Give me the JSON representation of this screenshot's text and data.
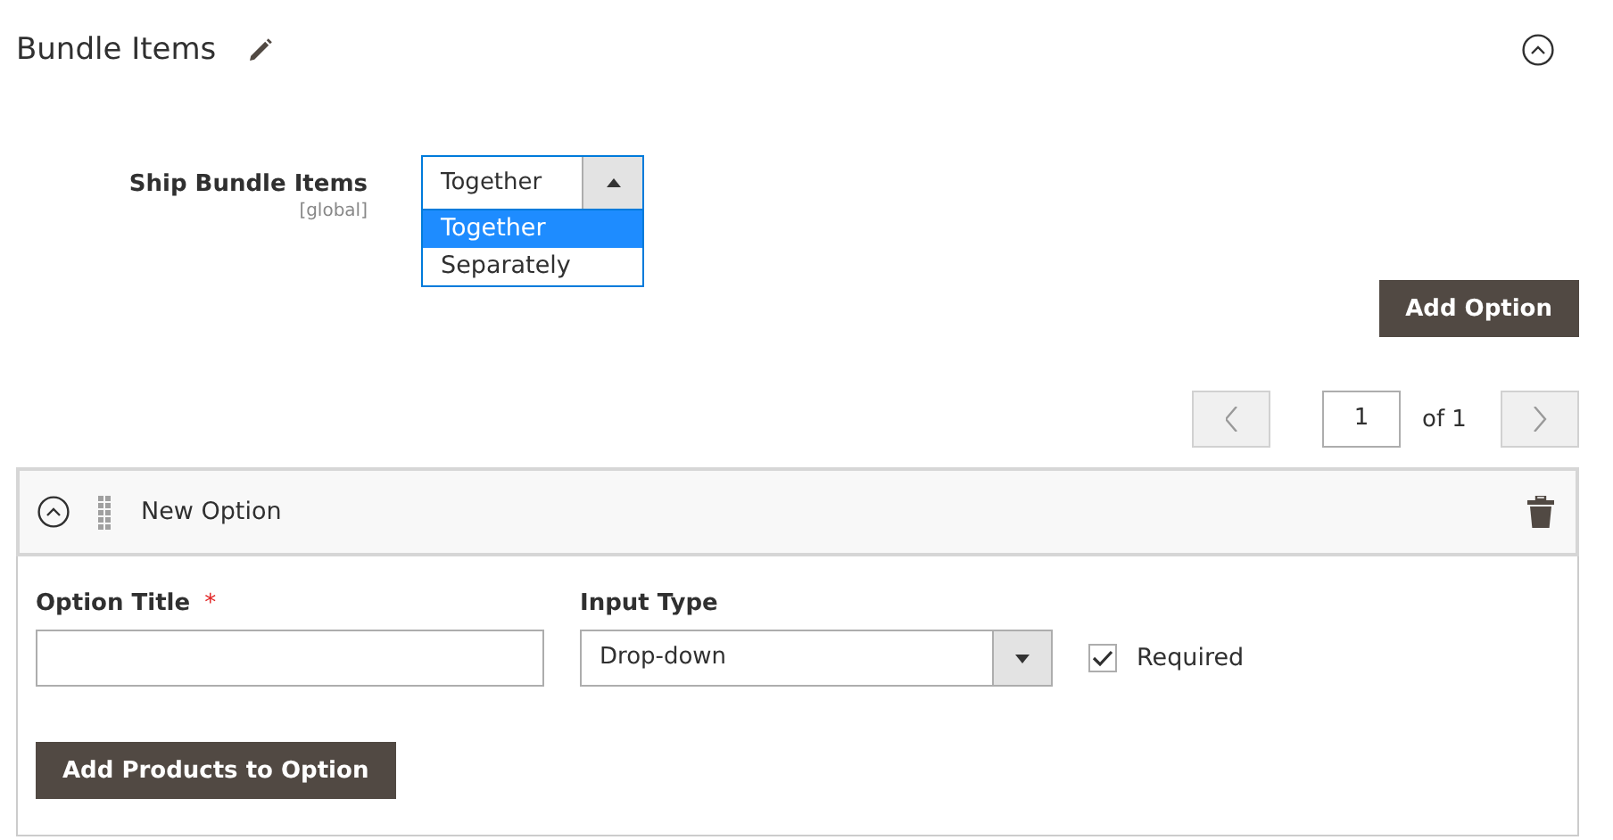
{
  "section": {
    "title": "Bundle Items",
    "expanded": true
  },
  "ship_bundle_items": {
    "label": "Ship Bundle Items",
    "scope": "[global]",
    "value": "Together",
    "open": true,
    "options": [
      {
        "label": "Together",
        "selected": true
      },
      {
        "label": "Separately",
        "selected": false
      }
    ]
  },
  "add_option_button": "Add Option",
  "pager": {
    "page": "1",
    "of": "of 1"
  },
  "options": [
    {
      "header": "New Option",
      "expanded": true,
      "option_title": {
        "label": "Option Title",
        "required_mark": "*"
      },
      "input_type": {
        "label": "Input Type",
        "value": "Drop-down"
      },
      "required": {
        "label": "Required",
        "checked": true
      },
      "add_products_button": "Add Products to Option"
    }
  ]
}
